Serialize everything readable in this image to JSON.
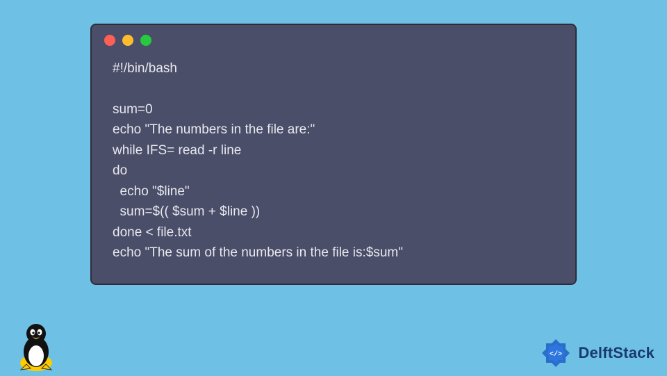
{
  "code": {
    "lines": [
      "#!/bin/bash",
      "",
      "sum=0",
      "echo \"The numbers in the file are:\"",
      "while IFS= read -r line",
      "do",
      "  echo \"$line\"",
      "  sum=$(( $sum + $line ))",
      "done < file.txt",
      "echo \"The sum of the numbers in the file is:$sum\""
    ]
  },
  "brand": {
    "name": "DelftStack"
  },
  "colors": {
    "bg": "#6ec1e4",
    "window": "#4a4e69",
    "text": "#e8e8ef",
    "brand": "#1a3a6e"
  }
}
